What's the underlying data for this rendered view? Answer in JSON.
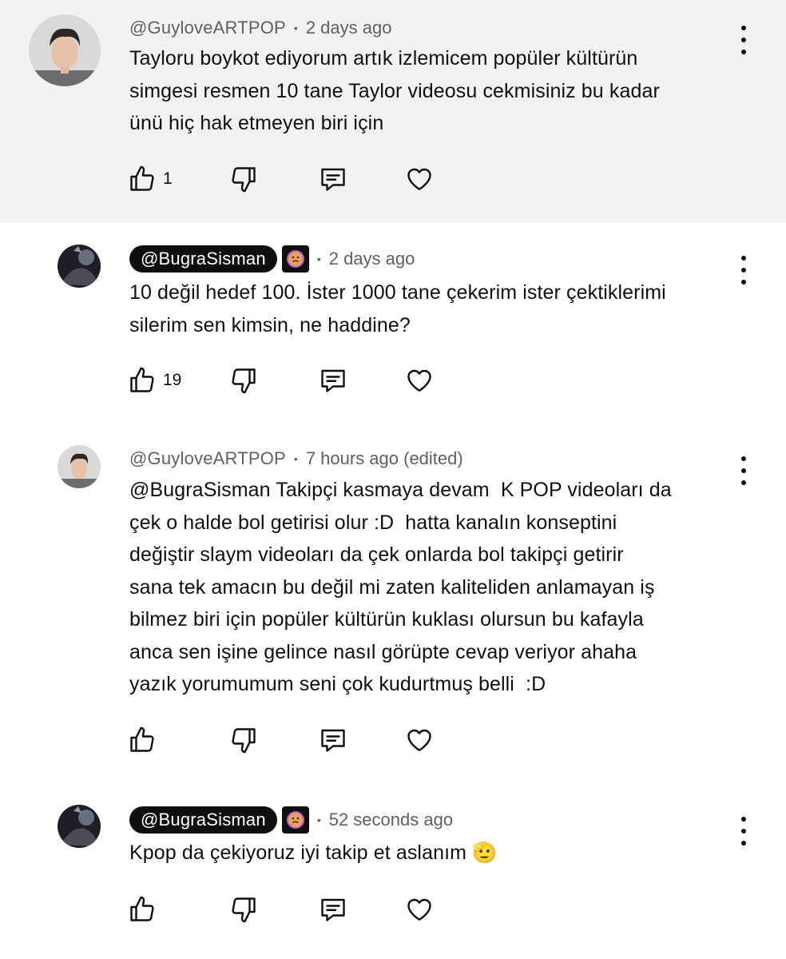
{
  "comments": [
    {
      "author": "@GuyloveARTPOP",
      "time": "2 days ago",
      "text": "Tayloru boykot ediyorum artık izlemicem popüler kültürün\nsimgesi resmen 10 tane Taylor videosu cekmisiniz bu kadar\nünü hiç hak etmeyen biri için",
      "likes": "1"
    },
    {
      "author": "@BugraSisman",
      "time": "2 days ago",
      "text": "10 değil hedef 100. İster 1000 tane çekerim ister çektiklerimi\nsilerim sen kimsin, ne haddine?",
      "likes": "19"
    },
    {
      "author": "@GuyloveARTPOP",
      "time": "7 hours ago (edited)",
      "text": "@BugraSisman Takipçi kasmaya devam  K POP videoları da\nçek o halde bol getirisi olur :D  hatta kanalın konseptini\ndeğiştir slaym videoları da çek onlarda bol takipçi getirir\nsana tek amacın bu değil mi zaten kaliteliden anlamayan iş\nbilmez biri için popüler kültürün kuklası olursun bu kafayla\nanca sen işine gelince nasıl görüpte cevap veriyor ahaha\nyazık yorumumum seni çok kudurtmuş belli  :D",
      "likes": ""
    },
    {
      "author": "@BugraSisman",
      "time": "52 seconds ago",
      "text": "Kpop da çekiyoruz iyi takip et aslanım 🫡",
      "likes": ""
    }
  ],
  "separator": "•",
  "icons": {
    "like": "thumbs-up-icon",
    "dislike": "thumbs-down-icon",
    "reply": "reply-icon",
    "heart": "heart-icon",
    "more": "more-vertical-icon",
    "badge": "member-badge-icon"
  },
  "colors": {
    "highlight_bg": "#f2f2f2",
    "text": "#0f0f0f",
    "meta": "#606060",
    "pill_bg": "#0f0f0f",
    "pill_text": "#ffffff"
  }
}
